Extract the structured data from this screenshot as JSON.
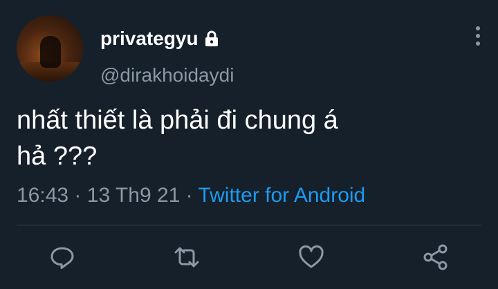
{
  "user": {
    "display_name": "privategyu",
    "handle": "@dirakhoidaydi",
    "protected": true
  },
  "tweet": {
    "text": "nhất thiết là phải đi chung á\nhả ???",
    "time": "16:43",
    "date": "13 Th9 21",
    "separator": "·",
    "source": "Twitter for Android"
  },
  "icons": {
    "lock": "lock-icon",
    "more": "more-vertical-icon",
    "reply": "reply-icon",
    "retweet": "retweet-icon",
    "like": "heart-icon",
    "share": "share-icon"
  },
  "colors": {
    "background": "#15202b",
    "secondary_text": "#8b98a5",
    "link": "#1d9bf0"
  }
}
